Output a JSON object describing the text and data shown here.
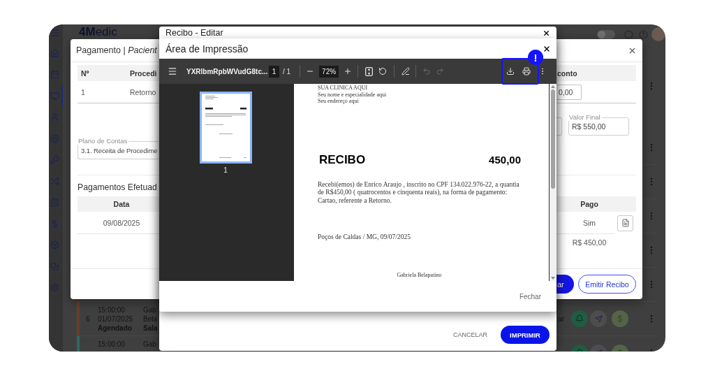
{
  "app": {
    "logo": "**4M**edic",
    "toggle": {
      "on": false
    },
    "sidebar": {
      "items": [
        {
          "selected": false
        },
        {
          "selected": false
        },
        {
          "selected": true
        },
        {
          "selected": false
        },
        {
          "selected": false
        },
        {
          "selected": false
        },
        {
          "selected": false
        },
        {
          "selected": false
        },
        {
          "selected": false
        },
        {
          "selected": false
        },
        {
          "selected": false
        },
        {
          "selected": false
        }
      ]
    },
    "appointments": [
      {
        "color": "#6b3e22",
        "number": "6",
        "time": "15:00:00",
        "date": "01/07/2025",
        "status": "Agendado",
        "professional": "Gab",
        "professional_line_2": "Bela",
        "room": "Sala",
        "confirmation": "ar"
      },
      {
        "color": "#2d6a5c",
        "time": "15:00:00",
        "professional": "Gab"
      }
    ]
  },
  "payment_dialog": {
    "title": "Pagamento | *Pacient*",
    "procedures_table": {
      "columns": [
        "Nº",
        "Procedi",
        "conto"
      ],
      "rows": [
        {
          "number": "1",
          "procedure": "Retorno",
          "discount": "0,00"
        }
      ]
    },
    "account_plan": {
      "label": "Plano de Contas",
      "value": "3.1. Receita de Procedime"
    },
    "final_value": {
      "label": "Valor Final",
      "value": "R$ 550,00"
    },
    "payments": {
      "title": "Pagamentos Efetuad",
      "columns": [
        "Data",
        "Pago"
      ],
      "rows": [
        {
          "date": "09/08/2025",
          "paid": "Sim"
        }
      ],
      "total": "R$ 450,00"
    },
    "buttons": [
      {
        "label": "ar",
        "kind": "primary"
      },
      {
        "label": "Emitir Recibo",
        "kind": "outline"
      }
    ]
  },
  "receipt_dialog": {
    "title": "Recibo - Editar",
    "buttons": [
      {
        "label": "CANCELAR",
        "kind": "text"
      },
      {
        "label": "IMPRIMIR",
        "kind": "primary"
      }
    ]
  },
  "print_dialog": {
    "title": "Área de Impressão",
    "viewer": {
      "file_name": "YXRlbmRpbWVudG8tc...",
      "page": "1",
      "page_count": "/ 1",
      "zoom": "72%",
      "undo": {
        "disabled": true
      },
      "redo": {
        "disabled": true
      },
      "highlight_badge": "!",
      "thumbnails": [
        {
          "label": "1",
          "selected": true
        }
      ],
      "document": {
        "header_lines": [
          "SUA CLINICA AQUI",
          "Seu nome e especialidade aqui",
          "Seu endereço aqui"
        ],
        "title": "RECIBO",
        "amount": "450,00",
        "body": "Recebi(emos) de Enrico Araujo , inscrito no CPF 134.022.976-22, a quantia de R$450,00 ( quatrocentos e cinquenta reais), na forma de pagamento: Cartao, referente a Retorno.",
        "place_date": "Poços de Caldas / MG, 09/07/2025",
        "signature": "Gabriela Belapatino"
      }
    },
    "buttons": [
      "Fechar"
    ]
  }
}
